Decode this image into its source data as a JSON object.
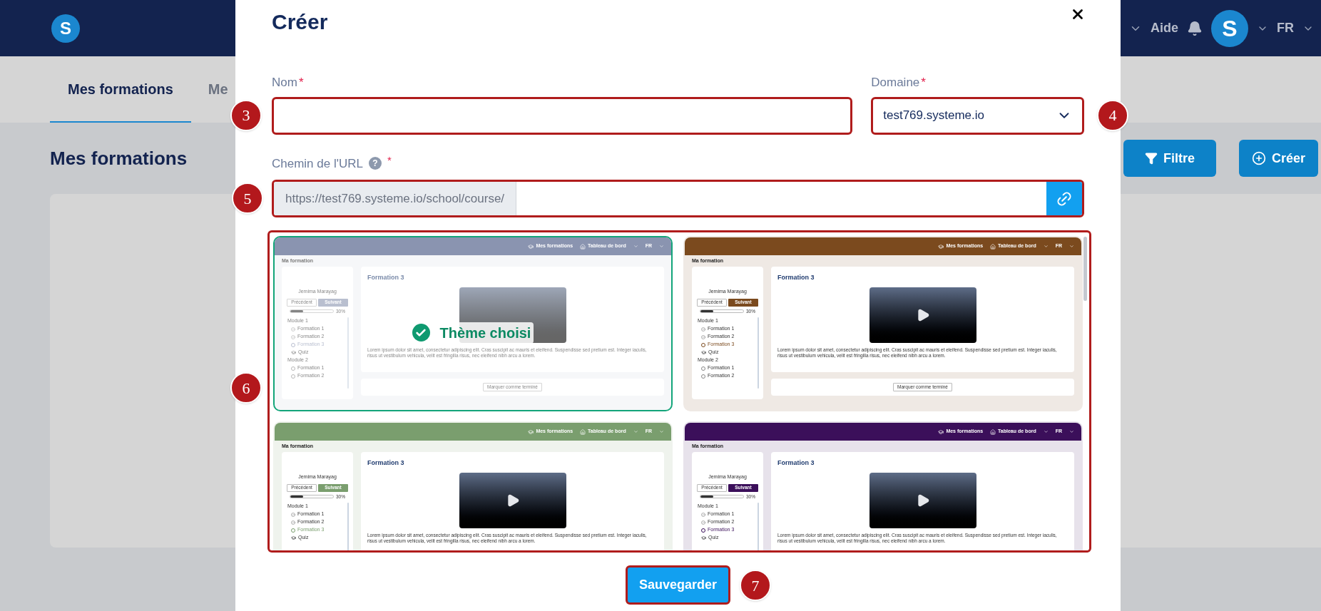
{
  "app_header": {
    "logo": "S",
    "help": "Aide",
    "avatar": "S",
    "language": "FR"
  },
  "tabs": [
    {
      "label": "Mes formations",
      "selected": true
    },
    {
      "label": "Me",
      "selected": false
    }
  ],
  "page_title": "Mes formations",
  "actions": [
    {
      "label": "Filtre",
      "kind": "filter"
    },
    {
      "label": "Créer",
      "kind": "create"
    }
  ],
  "dialog": {
    "title": "Créer",
    "name_field": {
      "label": "Nom",
      "required_mark": "*",
      "annotation": "3"
    },
    "domain_field": {
      "label": "Domaine",
      "required_mark": "*",
      "value": "test769.systeme.io",
      "annotation": "4"
    },
    "url_field": {
      "label": "Chemin de l'URL",
      "help_icon": "?",
      "required_mark": "*",
      "prefix": "https://test769.systeme.io/school/course/",
      "annotation": "5"
    },
    "themes": {
      "annotation": "6",
      "selected_label": "Thème choisi",
      "items": [
        {
          "selected": true,
          "color": "#8a94b0",
          "nav": [
            "Mes formations",
            "Tableau de bord"
          ],
          "language": "FR",
          "page_label": "Ma formation",
          "author": "Jemima Marayag",
          "prev": "Précédent",
          "next": "Suivant",
          "level": 0.3,
          "reading": "30%",
          "course_title": "Formation 3",
          "description": "Lorem ipsum dolor sit amet, consectetur adipiscing elit. Cras suscipit ac mauris et eleifend. Suspendisse sed pretium est. Integer iaculis, risus ut vestibulum vehicula, velit est fringilla risus, nec eleifend nibh arcu a lorem.",
          "mark_done": "Marquer comme terminé",
          "lessons": [
            {
              "kind": "module",
              "label": "Module 1"
            },
            {
              "kind": "lesson",
              "done": true,
              "current": false,
              "label": "Formation 1"
            },
            {
              "kind": "lesson",
              "done": true,
              "current": false,
              "label": "Formation 2"
            },
            {
              "kind": "lesson",
              "done": false,
              "current": true,
              "label": "Formation 3"
            },
            {
              "kind": "quiz",
              "label": "Quiz"
            },
            {
              "kind": "module",
              "label": "Module 2"
            },
            {
              "kind": "lesson",
              "done": false,
              "current": false,
              "label": "Formation 1"
            },
            {
              "kind": "lesson",
              "done": false,
              "current": false,
              "label": "Formation 2"
            }
          ]
        },
        {
          "selected": false,
          "color": "#7b4a1e",
          "nav": [
            "Mes formations",
            "Tableau de bord"
          ],
          "language": "FR",
          "page_label": "Ma formation",
          "author": "Jemima Marayag",
          "prev": "Précédent",
          "next": "Suivant",
          "level": 0.3,
          "reading": "30%",
          "course_title": "Formation 3",
          "description": "Lorem ipsum dolor sit amet, consectetur adipiscing elit. Cras suscipit ac mauris et eleifend. Suspendisse sed pretium est. Integer iaculis, risus ut vestibulum vehicula, velit est fringilla risus, nec eleifend nibh arcu a lorem.",
          "mark_done": "Marquer comme terminé",
          "lessons": [
            {
              "kind": "module",
              "label": "Module 1"
            },
            {
              "kind": "lesson",
              "done": true,
              "current": false,
              "label": "Formation 1"
            },
            {
              "kind": "lesson",
              "done": true,
              "current": false,
              "label": "Formation 2"
            },
            {
              "kind": "lesson",
              "done": false,
              "current": true,
              "label": "Formation 3"
            },
            {
              "kind": "quiz",
              "label": "Quiz"
            },
            {
              "kind": "module",
              "label": "Module 2"
            },
            {
              "kind": "lesson",
              "done": false,
              "current": false,
              "label": "Formation 1"
            },
            {
              "kind": "lesson",
              "done": false,
              "current": false,
              "label": "Formation 2"
            }
          ]
        },
        {
          "selected": false,
          "color": "#7a9e6e",
          "nav": [
            "Mes formations",
            "Tableau de bord"
          ],
          "language": "FR",
          "page_label": "Ma formation",
          "author": "Jemima Marayag",
          "prev": "Précédent",
          "next": "Suivant",
          "level": 0.3,
          "reading": "30%",
          "course_title": "Formation 3",
          "description": "Lorem ipsum dolor sit amet, consectetur adipiscing elit. Cras suscipit ac mauris et eleifend. Suspendisse sed pretium est. Integer iaculis, risus ut vestibulum vehicula, velit est fringilla risus, nec eleifend nibh arcu a lorem.",
          "lessons": [
            {
              "kind": "module",
              "label": "Module 1"
            },
            {
              "kind": "lesson",
              "done": true,
              "current": false,
              "label": "Formation 1"
            },
            {
              "kind": "lesson",
              "done": true,
              "current": false,
              "label": "Formation 2"
            },
            {
              "kind": "lesson",
              "done": false,
              "current": true,
              "label": "Formation 3"
            },
            {
              "kind": "quiz",
              "label": "Quiz"
            }
          ]
        },
        {
          "selected": false,
          "color": "#3b0f5a",
          "nav": [
            "Mes formations",
            "Tableau de bord"
          ],
          "language": "FR",
          "page_label": "Ma formation",
          "author": "Jemima Marayag",
          "prev": "Précédent",
          "next": "Suivant",
          "level": 0.3,
          "reading": "30%",
          "course_title": "Formation 3",
          "description": "Lorem ipsum dolor sit amet, consectetur adipiscing elit. Cras suscipit ac mauris et eleifend. Suspendisse sed pretium est. Integer iaculis, risus ut vestibulum vehicula, velit est fringilla risus, nec eleifend nibh arcu a lorem.",
          "lessons": [
            {
              "kind": "module",
              "label": "Module 1"
            },
            {
              "kind": "lesson",
              "done": true,
              "current": false,
              "label": "Formation 1"
            },
            {
              "kind": "lesson",
              "done": true,
              "current": false,
              "label": "Formation 2"
            },
            {
              "kind": "lesson",
              "done": false,
              "current": true,
              "label": "Formation 3"
            },
            {
              "kind": "quiz",
              "label": "Quiz"
            }
          ]
        }
      ]
    },
    "save": {
      "label": "Sauvegarder",
      "annotation": "7"
    }
  }
}
